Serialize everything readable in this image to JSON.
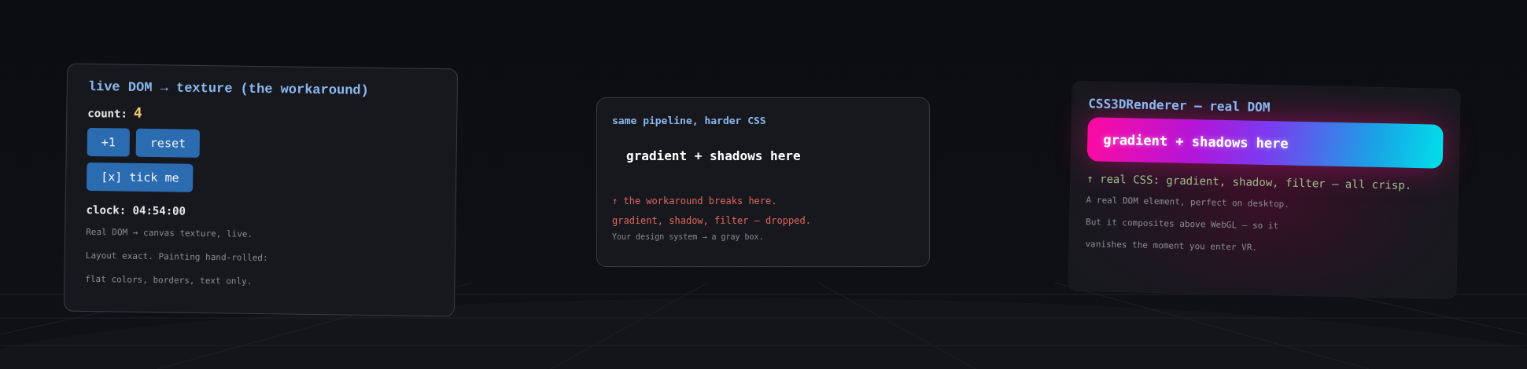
{
  "panels": [
    {
      "kind": "texture",
      "title": "live DOM → texture (the workaround)",
      "rows": [
        {
          "kind": "counter",
          "label": "count:",
          "value": "4"
        },
        {
          "kind": "buttons",
          "items": [
            "+1",
            "reset"
          ]
        },
        {
          "kind": "buttons",
          "items": [
            "[x] tick me"
          ]
        },
        {
          "kind": "clock",
          "text": "clock: 04:54:00"
        },
        {
          "kind": "note",
          "text": "Real DOM → canvas texture, live."
        },
        {
          "kind": "note",
          "text": "Layout exact. Painting hand-rolled:"
        },
        {
          "kind": "note",
          "text": "flat colors, borders, text only."
        }
      ]
    },
    {
      "kind": "flat",
      "title": "same pipeline, harder CSS",
      "rows": [
        {
          "kind": "plain_box",
          "text": "gradient + shadows here"
        },
        {
          "kind": "warning",
          "text": "↑ the workaround breaks here."
        },
        {
          "kind": "warning",
          "text": "gradient, shadow, filter — dropped."
        },
        {
          "kind": "note",
          "text": "Your design system → a gray box."
        }
      ]
    },
    {
      "kind": "css3d",
      "title": "CSS3DRenderer — real DOM",
      "rows": [
        {
          "kind": "gradient_box",
          "text": "gradient + shadows here"
        },
        {
          "kind": "success",
          "text": "↑ real CSS: gradient, shadow, filter — all crisp."
        },
        {
          "kind": "note",
          "text": "A real DOM element, perfect on desktop."
        },
        {
          "kind": "note",
          "text": "But it composites above WebGL — so it"
        },
        {
          "kind": "note",
          "text": "vanishes the moment you enter VR."
        }
      ]
    }
  ]
}
